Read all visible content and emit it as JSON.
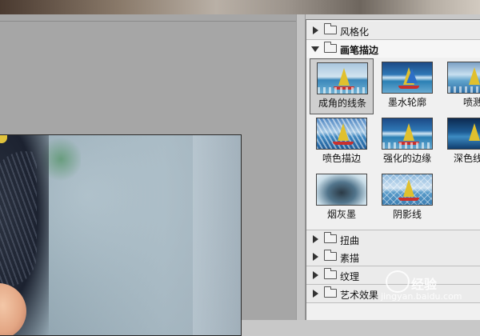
{
  "gallery": {
    "categories_top": [
      {
        "label": "风格化",
        "expanded": false
      },
      {
        "label": "画笔描边",
        "expanded": true
      }
    ],
    "filters": [
      {
        "label": "成角的线条",
        "art": "art-a",
        "selected": true
      },
      {
        "label": "墨水轮廓",
        "art": "art-b",
        "selected": false
      },
      {
        "label": "喷溅",
        "art": "art-c",
        "selected": false
      },
      {
        "label": "喷色描边",
        "art": "art-d",
        "selected": false
      },
      {
        "label": "强化的边缘",
        "art": "art-b",
        "selected": false
      },
      {
        "label": "深色线条",
        "art": "art-e",
        "selected": false
      },
      {
        "label": "烟灰墨",
        "art": "art-f",
        "selected": false
      },
      {
        "label": "阴影线",
        "art": "art-g",
        "selected": false
      }
    ],
    "categories_bottom": [
      {
        "label": "扭曲"
      },
      {
        "label": "素描"
      },
      {
        "label": "纹理"
      },
      {
        "label": "艺术效果"
      }
    ]
  },
  "watermark": {
    "text": "经验",
    "url": "jingyan.baidu.com"
  },
  "colors": {
    "panel_bg": "#f0f0f0",
    "selection_bg": "#cfcfcf",
    "preview_bg": "#a6a6a6"
  }
}
